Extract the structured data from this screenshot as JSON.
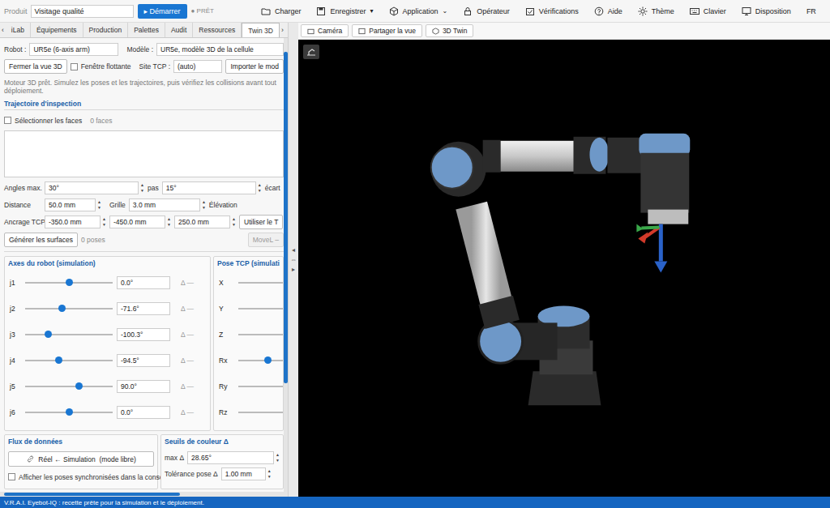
{
  "topbar": {
    "product_label": "Produit",
    "product_value": "Visitage qualité",
    "start_button": "▸ Démarrer",
    "status": "● PRÊT",
    "menu": [
      {
        "label": "Charger"
      },
      {
        "label": "Enregistrer",
        "caret": "▾"
      },
      {
        "label": "Application",
        "caret": "⌄"
      },
      {
        "label": "Opérateur"
      },
      {
        "label": "Vérifications"
      },
      {
        "label": "Aide"
      },
      {
        "label": "Thème"
      },
      {
        "label": "Clavier"
      },
      {
        "label": "Disposition"
      },
      {
        "label": "FR"
      }
    ]
  },
  "tabs": {
    "prev": "‹",
    "next": "›",
    "items": [
      {
        "label": "iLab",
        "selected": false
      },
      {
        "label": "Équipements",
        "selected": false
      },
      {
        "label": "Production",
        "selected": false
      },
      {
        "label": "Palettes",
        "selected": false
      },
      {
        "label": "Audit",
        "selected": false
      },
      {
        "label": "Ressources",
        "selected": false
      },
      {
        "label": "Twin 3D",
        "selected": true
      }
    ]
  },
  "robot_row": {
    "robot_label": "Robot :",
    "robot_value": "UR5e (6-axis arm)",
    "model_label": "Modèle :",
    "model_value": "UR5e, modèle 3D de la cellule"
  },
  "view_row": {
    "close_button": "Fermer la vue 3D",
    "floating": {
      "label": "Fenêtre flottante",
      "checked": false
    },
    "tcp_label": "Site TCP :",
    "tcp_value": "(auto)",
    "import_button": "Importer le mod"
  },
  "info": "Moteur 3D prêt. Simulez les poses et les trajectoires, puis vérifiez les collisions avant tout déploiement.",
  "spin_up": "▲",
  "spin_down": "▼",
  "trajectory": {
    "title": "Trajectoire d'inspection",
    "select_faces": {
      "label": "Sélectionner les faces",
      "checked": false
    },
    "faces_count": "0 faces",
    "angles_label": "Angles max.",
    "angles_value": "30°",
    "step_label": "pas",
    "step_value": "15°",
    "gap_label": "écart",
    "distance_label": "Distance",
    "distance_value": "50.0 mm",
    "grid_label": "Grille",
    "grid_value": "3.0 mm",
    "elevation_label": "Élévation",
    "anchor_label": "Ancrage TCP",
    "anchor_values": [
      "-350.0 mm",
      "-450.0 mm",
      "250.0 mm"
    ],
    "use_tcp_button": "Utiliser le T",
    "generate_button": "Générer les surfaces",
    "poses_count": "0 poses",
    "movel_button": {
      "label": "MoveL –",
      "disabled": true
    }
  },
  "axes": {
    "title": "Axes du robot (simulation)",
    "joints": [
      {
        "name": "j1",
        "value": "0.0°",
        "level": 0.5,
        "delta": "Δ —"
      },
      {
        "name": "j2",
        "value": "-71.6°",
        "level": 0.42,
        "delta": "Δ —"
      },
      {
        "name": "j3",
        "value": "-100.3°",
        "level": 0.26,
        "delta": "Δ —"
      },
      {
        "name": "j4",
        "value": "-94.5°",
        "level": 0.38,
        "delta": "Δ —"
      },
      {
        "name": "j5",
        "value": "90.0°",
        "level": 0.61,
        "delta": "Δ —"
      },
      {
        "name": "j6",
        "value": "0.0°",
        "level": 0.5,
        "delta": "Δ —"
      }
    ]
  },
  "pose": {
    "title": "Pose TCP (simulati",
    "fields": [
      {
        "name": "X",
        "level": 0.75
      },
      {
        "name": "Y",
        "level": 0.75
      },
      {
        "name": "Z",
        "level": 0.75
      },
      {
        "name": "Rx",
        "level": 0.4
      },
      {
        "name": "Ry",
        "level": 0.75
      },
      {
        "name": "Rz",
        "level": 0.75
      }
    ]
  },
  "flux": {
    "title": "Flux de données",
    "link_button": "Réel ← Simulation  (mode libre)",
    "sync": {
      "label": "Afficher les poses synchronisées dans la console",
      "checked": false
    }
  },
  "thresholds": {
    "title": "Seuils de couleur Δ",
    "max_label": "max Δ",
    "max_value": "28.65°",
    "tolerance_label": "Tolérance pose Δ",
    "tolerance_value": "1.00 mm"
  },
  "scrollbars": {
    "vertical": 0.73,
    "horizontal": 0.62
  },
  "splitter": [
    "◂",
    "⇔",
    "▸"
  ],
  "viewport": {
    "buttons": [
      "Caméra",
      "Partager la vue",
      "3D Twin"
    ]
  },
  "status_bar": "V.R.A.I. Eyebot-IQ : recette prête pour la simulation et le déploiement."
}
